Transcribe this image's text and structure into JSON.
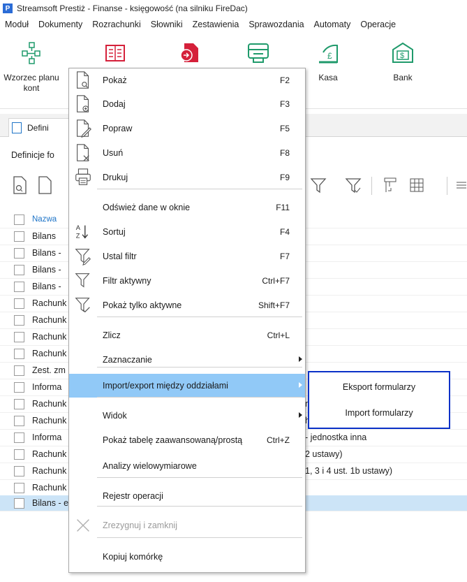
{
  "window": {
    "title": "Streamsoft Prestiż - Finanse - księgowość (na silniku FireDac)",
    "logo": "P"
  },
  "menubar": [
    "Moduł",
    "Dokumenty",
    "Rozrachunki",
    "Słowniki",
    "Zestawienia",
    "Sprawozdania",
    "Automaty",
    "Operacje"
  ],
  "ribbon": [
    {
      "label": "Wzorzec planu kont",
      "icon": "chart-of-accounts-icon"
    },
    {
      "label": "",
      "icon": "documents-icon"
    },
    {
      "label": "",
      "icon": "document-export-icon"
    },
    {
      "label": "",
      "icon": "register-icon"
    },
    {
      "label": "Kasa",
      "icon": "cash-register-icon"
    },
    {
      "label": "Bank",
      "icon": "bank-icon"
    }
  ],
  "tab": {
    "label": "Defini"
  },
  "breadcrumb": "Definicje fo",
  "list": {
    "header": "Nazwa",
    "rows": [
      {
        "name": "Bilans",
        "extra": ""
      },
      {
        "name": "Bilans -",
        "extra": ""
      },
      {
        "name": "Bilans -",
        "extra": ""
      },
      {
        "name": "Bilans -",
        "extra": ""
      },
      {
        "name": "Rachunk",
        "extra": ""
      },
      {
        "name": "Rachunk",
        "extra": ""
      },
      {
        "name": "Rachunk",
        "extra": ""
      },
      {
        "name": "Rachunk",
        "extra": ""
      },
      {
        "name": "Zest. zm",
        "extra": ""
      },
      {
        "name": "Informa",
        "extra": ""
      },
      {
        "name": "Rachunk",
        "extra": "mała"
      },
      {
        "name": "Rachunk",
        "extra": "h przedsiębiorstw"
      },
      {
        "name": "Informa",
        "extra": "- jednostka inna"
      },
      {
        "name": "Rachunk",
        "extra": "2 ustawy)"
      },
      {
        "name": "Rachunk",
        "extra": "1, 3 i 4 ust. 1b ustawy)"
      },
      {
        "name": "Rachunk",
        "extra": ""
      }
    ],
    "selected_row": "Bilans - estoński"
  },
  "context_menu": {
    "items": [
      {
        "label": "Pokaż",
        "shortcut": "F2",
        "icon": "document-preview-icon"
      },
      {
        "label": "Dodaj",
        "shortcut": "F3",
        "icon": "document-add-icon"
      },
      {
        "label": "Popraw",
        "shortcut": "F5",
        "icon": "document-edit-icon"
      },
      {
        "label": "Usuń",
        "shortcut": "F8",
        "icon": "document-delete-icon"
      },
      {
        "label": "Drukuj",
        "shortcut": "F9",
        "icon": "printer-icon"
      },
      {
        "label": "Odśwież dane w oknie",
        "shortcut": "F11",
        "icon": ""
      },
      {
        "label": "Sortuj",
        "shortcut": "F4",
        "icon": "sort-az-icon"
      },
      {
        "label": "Ustal filtr",
        "shortcut": "F7",
        "icon": "filter-edit-icon"
      },
      {
        "label": "Filtr aktywny",
        "shortcut": "Ctrl+F7",
        "icon": "filter-icon"
      },
      {
        "label": "Pokaż tylko aktywne",
        "shortcut": "Shift+F7",
        "icon": "filter-check-icon"
      },
      {
        "label": "Zlicz",
        "shortcut": "Ctrl+L",
        "icon": ""
      },
      {
        "label": "Zaznaczanie",
        "shortcut": "",
        "icon": ""
      },
      {
        "label": "Import/export między oddziałami",
        "shortcut": "",
        "icon": ""
      },
      {
        "label": "Widok",
        "shortcut": "",
        "icon": ""
      },
      {
        "label": "Pokaż tabelę zaawansowaną/prostą",
        "shortcut": "Ctrl+Z",
        "icon": ""
      },
      {
        "label": "Analizy wielowymiarowe",
        "shortcut": "",
        "icon": ""
      },
      {
        "label": "Rejestr operacji",
        "shortcut": "",
        "icon": ""
      },
      {
        "label": "Zrezygnuj i zamknij",
        "shortcut": "",
        "icon": "close-icon"
      },
      {
        "label": "Kopiuj komórkę",
        "shortcut": "",
        "icon": ""
      }
    ]
  },
  "submenu": {
    "items": [
      "Eksport formularzy",
      "Import formularzy"
    ]
  },
  "colors": {
    "highlight": "#91c9f7",
    "submenu_border": "#0a31c7",
    "selected_row": "#cce4f7",
    "link_blue": "#1e74c7",
    "ribbon_red": "#d5203a",
    "ribbon_green": "#1f9a6b"
  }
}
